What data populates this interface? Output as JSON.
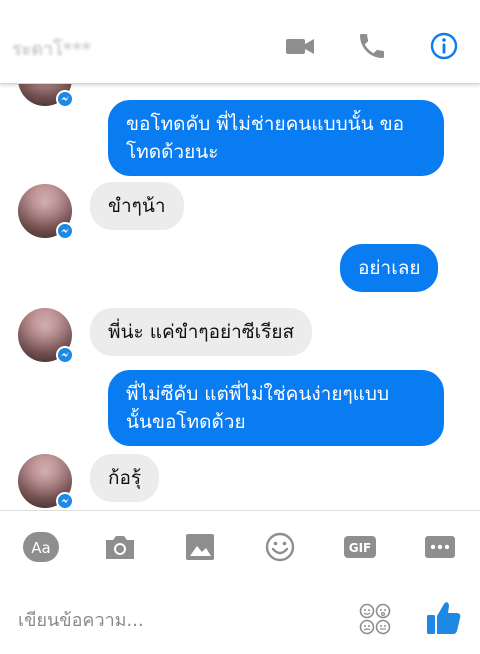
{
  "header": {
    "contact_name": "ระดาโ***",
    "icons": [
      "video-camera-icon",
      "phone-icon",
      "info-icon"
    ]
  },
  "messages": [
    {
      "side": "out",
      "text_line1": "ขอโทดคับ พี่ไม่ช่ายคนแบบนั้น ขอ",
      "text_line2": "โทดด้วยนะ"
    },
    {
      "side": "in",
      "text": "ขำๆน้า"
    },
    {
      "side": "out",
      "text": "อย่าเลย"
    },
    {
      "side": "in",
      "text": "พี่น่ะ แค่ขำๆอย่าซีเรียส"
    },
    {
      "side": "out",
      "text_line1": "พี่ไม่ซีคับ แต่พี่ไม่ใช่คนง่ายๆแบบ",
      "text_line2": "นั้นขอโทดด้วย"
    },
    {
      "side": "in",
      "text": "ก้อรุ้"
    }
  ],
  "composer": {
    "aa_label": "Aa",
    "gif_label": "GIF",
    "placeholder": "เขียนข้อความ...",
    "toolbar_icons": [
      "text-format-icon",
      "camera-icon",
      "image-icon",
      "emoji-icon",
      "gif-icon",
      "more-icon"
    ]
  },
  "colors": {
    "accent": "#0a7cf2",
    "icon_gray": "#8e8e8e",
    "incoming_bubble": "#ececec",
    "like_blue": "#1e88e5"
  }
}
